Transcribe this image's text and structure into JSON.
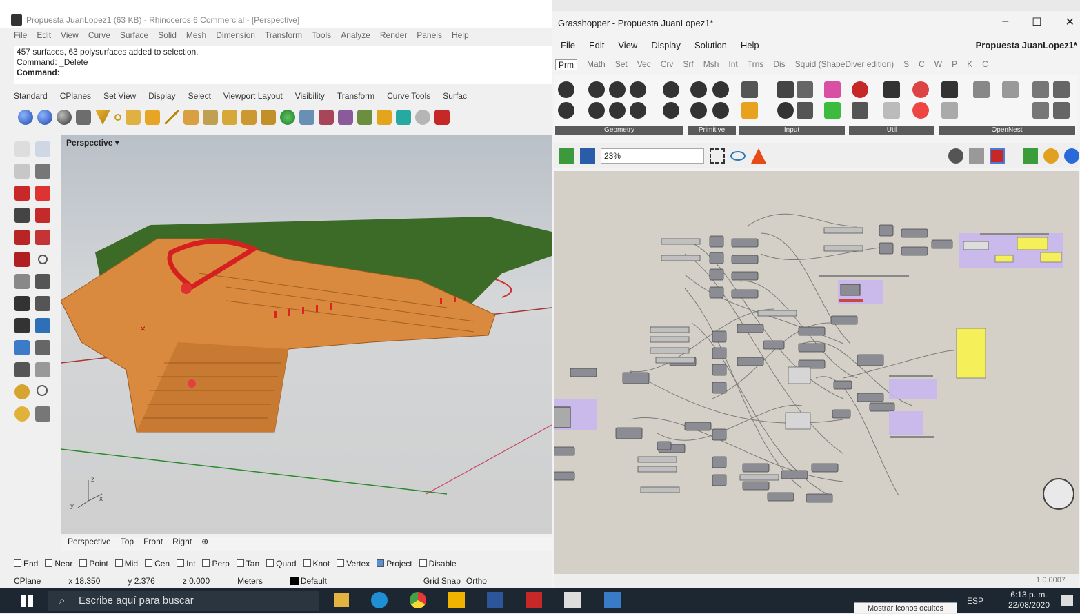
{
  "rhino": {
    "title": "Propuesta JuanLopez1 (63 KB) - Rhinoceros 6 Commercial - [Perspective]",
    "menu": [
      "File",
      "Edit",
      "View",
      "Curve",
      "Surface",
      "Solid",
      "Mesh",
      "Dimension",
      "Transform",
      "Tools",
      "Analyze",
      "Render",
      "Panels",
      "Help"
    ],
    "command_history": [
      "457 surfaces, 63 polysurfaces added to selection.",
      "Command: _Delete"
    ],
    "command_prompt": "Command:",
    "toolbar_tabs": [
      "Standard",
      "CPlanes",
      "Set View",
      "Display",
      "Select",
      "Viewport Layout",
      "Visibility",
      "Transform",
      "Curve Tools",
      "Surfac"
    ],
    "viewport_label": "Perspective",
    "viewport_tabs": [
      "Perspective",
      "Top",
      "Front",
      "Right"
    ],
    "osnaps": [
      {
        "label": "End",
        "checked": false
      },
      {
        "label": "Near",
        "checked": false
      },
      {
        "label": "Point",
        "checked": false
      },
      {
        "label": "Mid",
        "checked": false
      },
      {
        "label": "Cen",
        "checked": false
      },
      {
        "label": "Int",
        "checked": false
      },
      {
        "label": "Perp",
        "checked": false
      },
      {
        "label": "Tan",
        "checked": false
      },
      {
        "label": "Quad",
        "checked": false
      },
      {
        "label": "Knot",
        "checked": false
      },
      {
        "label": "Vertex",
        "checked": false
      },
      {
        "label": "Project",
        "checked": true
      },
      {
        "label": "Disable",
        "checked": false
      }
    ],
    "status": {
      "cplane": "CPlane",
      "x": "x 18.350",
      "y": "y 2.376",
      "z": "z 0.000",
      "units": "Meters",
      "layer": "Default",
      "grid_snap": "Grid Snap",
      "ortho": "Ortho"
    },
    "axis_labels": {
      "z": "z",
      "x": "x",
      "y": "y"
    }
  },
  "grasshopper": {
    "title": "Grasshopper - Propuesta JuanLopez1*",
    "window_buttons": [
      "–",
      "☐",
      "✕"
    ],
    "menu": [
      "File",
      "Edit",
      "View",
      "Display",
      "Solution",
      "Help"
    ],
    "document_name": "Propuesta JuanLopez1*",
    "tabs": [
      "Prm",
      "Math",
      "Set",
      "Vec",
      "Crv",
      "Srf",
      "Msh",
      "Int",
      "Trns",
      "Dis",
      "Squid (ShapeDiver edition)",
      "S",
      "C",
      "W",
      "P",
      "K",
      "C"
    ],
    "ribbon_groups": [
      "Geometry",
      "Primitive",
      "Input",
      "Util",
      "OpenNest"
    ],
    "zoom": "23%",
    "status_left": "...",
    "version": "1.0.0007"
  },
  "taskbar": {
    "search_placeholder": "Escribe aquí para buscar",
    "language": "ESP",
    "time": "6:13 p. m.",
    "date": "22/08/2020",
    "tooltip": "Mostrar iconos ocultos"
  },
  "colors": {
    "terrain_green": "#3c6b28",
    "wood_orange": "#d98a3e",
    "path_red": "#d62020",
    "gh_canvas": "#d4d0c8",
    "gh_group_purple": "#c9b6ee",
    "gh_panel_yellow": "#f5ef5a",
    "taskbar": "#1d2731"
  }
}
